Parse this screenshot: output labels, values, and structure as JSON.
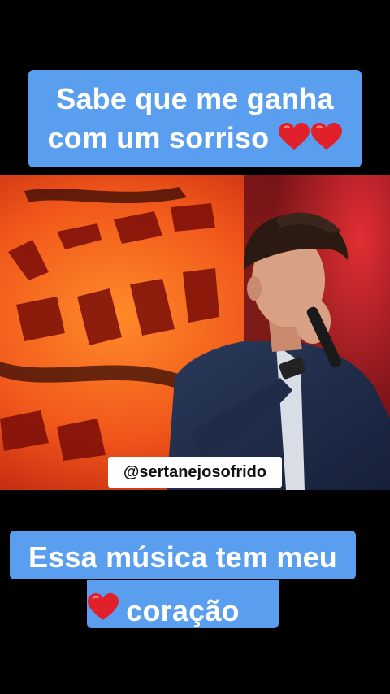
{
  "caption_top": {
    "line1": "Sabe que me ganha",
    "line2": "com um sorriso",
    "emoji": [
      "red-heart",
      "red-heart"
    ]
  },
  "watermark": {
    "handle": "@sertanejosofrido"
  },
  "caption_bottom": {
    "line1": "Essa música tem meu",
    "line2": "coração",
    "emoji": [
      "red-heart"
    ]
  },
  "colors": {
    "caption_bg": "#5a9ef0",
    "background": "#000000",
    "heart": "#e0202a"
  }
}
